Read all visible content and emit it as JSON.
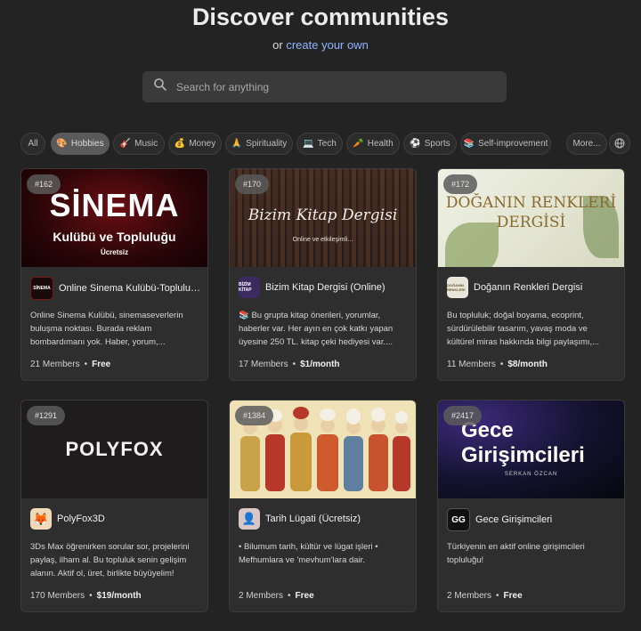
{
  "header": {
    "title": "Discover communities",
    "subtitle_prefix": "or",
    "create_link": "create your own"
  },
  "search": {
    "placeholder": "Search for anything"
  },
  "filters": [
    {
      "label": "All",
      "emoji": ""
    },
    {
      "label": "Hobbies",
      "emoji": "🎨"
    },
    {
      "label": "Music",
      "emoji": "🎸"
    },
    {
      "label": "Money",
      "emoji": "💰"
    },
    {
      "label": "Spirituality",
      "emoji": "🙏"
    },
    {
      "label": "Tech",
      "emoji": "💻"
    },
    {
      "label": "Health",
      "emoji": "🥕"
    },
    {
      "label": "Sports",
      "emoji": "⚽"
    },
    {
      "label": "Self-improvement",
      "emoji": "📚"
    },
    {
      "label": "More...",
      "emoji": ""
    }
  ],
  "active_filter": "Hobbies",
  "cards": [
    {
      "rank": "#162",
      "banner_line1": "SİNEMA",
      "banner_line2": "Kulübü ve Topluluğu",
      "banner_line3": "Ücretsiz",
      "logo_text": "SİNEMA",
      "name": "Online Sinema Kulübü-Topluluğu",
      "description": "Online Sinema Kulübü, sinemaseverlerin buluşma noktası. Burada reklam bombardımanı yok. Haber, yorum,...",
      "members": "21 Members",
      "price": "Free"
    },
    {
      "rank": "#170",
      "banner_line1": "Bizim Kitap Dergisi",
      "banner_line2": "Online ve etkileşimli...",
      "logo_text": "BİZİM KİTAP",
      "name": "Bizim Kitap Dergisi (Online)",
      "description": "📚 Bu grupta kitap önerileri, yorumlar, haberler var. Her ayın en çok katkı yapan üyesine 250 TL. kitap çeki hediyesi var....",
      "members": "17 Members",
      "price": "$1/month"
    },
    {
      "rank": "#172",
      "banner_line1": "DOĞANIN RENKLERİ",
      "banner_line2": "DERGİSİ",
      "logo_text": "DOĞANIN RENKLERİ",
      "name": "Doğanın Renkleri Dergisi",
      "description": "Bu topluluk; doğal boyama, ecoprint, sürdürülebilir tasarım, yavaş moda ve kültürel miras hakkında bilgi paylaşımı,...",
      "members": "11 Members",
      "price": "$8/month"
    },
    {
      "rank": "#1291",
      "banner_line1": "POLYFOX",
      "logo_text": "🦊",
      "name": "PolyFox3D",
      "description": "3Ds Max öğrenirken sorular sor, projelerini paylaş, ilham al. Bu topluluk senin gelişim alanın. Aktif ol, üret, birlikte büyüyelim!",
      "members": "170 Members",
      "price": "$19/month"
    },
    {
      "rank": "#1384",
      "logo_text": "👤",
      "name": "Tarih Lügati (Ücretsiz)",
      "description": "• Bilumum tarih, kültür ve lügat işleri • Mefhumlara ve 'mevhum'lara dair.",
      "members": "2 Members",
      "price": "Free"
    },
    {
      "rank": "#2417",
      "banner_line1": "Gece",
      "banner_line2": "Girişimcileri",
      "banner_line3": "SERKAN ÖZCAN",
      "logo_text": "GG",
      "name": "Gece Girişimcileri",
      "description": "Türkiyenin en aktif online girişimcileri topluluğu!",
      "members": "2 Members",
      "price": "Free"
    }
  ],
  "colors": {
    "background": "#232323",
    "card": "#2e2e2e",
    "link": "#8fb4ff"
  }
}
